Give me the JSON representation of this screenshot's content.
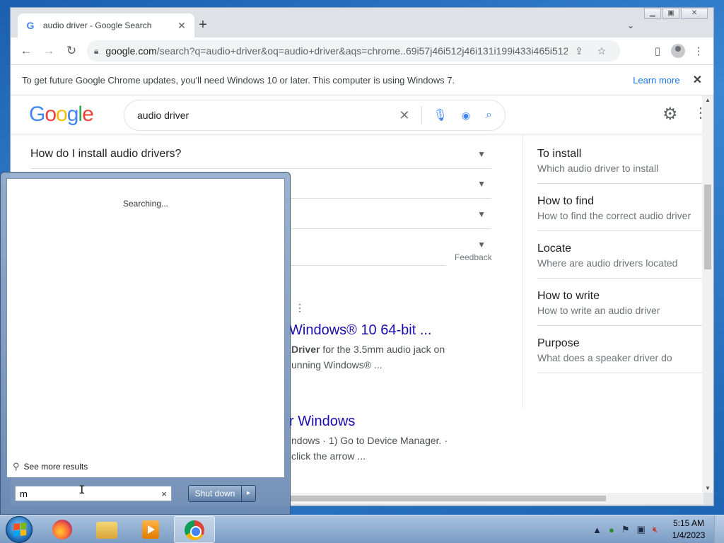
{
  "browser": {
    "tab_title": "audio driver - Google Search",
    "tab_close": "✕",
    "new_tab": "+",
    "url_host": "google.com",
    "url_path": "/search?q=audio+driver&oq=audio+driver&aqs=chrome..69i57j46i512j46i131i199i433i465i512j...",
    "infobar_message": "To get future Google Chrome updates, you'll need Windows 10 or later. This computer is using Windows 7.",
    "infobar_link": "Learn more",
    "infobar_close": "✕"
  },
  "google": {
    "logo": [
      "G",
      "o",
      "o",
      "g",
      "l",
      "e"
    ],
    "query": "audio driver",
    "clear": "✕"
  },
  "paa": {
    "questions": [
      "How do I install audio drivers?",
      "",
      "",
      ""
    ],
    "feedback": "Feedback"
  },
  "results": [
    {
      "title": "Windows® 10 64-bit ...",
      "snippet_bold": "Driver",
      "snippet_1": " for the 3.5mm audio jack on",
      "snippet_2": "unning Windows® ..."
    },
    {
      "title": "r Windows",
      "snippet_1": "ndows · 1) Go to Device Manager. ·",
      "snippet_2": " click the arrow ..."
    }
  ],
  "related": [
    {
      "title": "To install",
      "subtitle": "Which audio driver to install"
    },
    {
      "title": "How to find",
      "subtitle": "How to find the correct audio driver"
    },
    {
      "title": "Locate",
      "subtitle": "Where are audio drivers located"
    },
    {
      "title": "How to write",
      "subtitle": "How to write an audio driver"
    },
    {
      "title": "Purpose",
      "subtitle": "What does a speaker driver do"
    }
  ],
  "start_menu": {
    "status": "Searching...",
    "see_more": "See more results",
    "search_value": "m",
    "search_clear": "×",
    "shutdown_label": "Shut down",
    "shutdown_arrow": "▸"
  },
  "taskbar": {
    "time": "5:15 AM",
    "date": "1/4/2023"
  },
  "colors": {
    "link": "#1a0dab",
    "accent": "#1a73e8",
    "taskbar": "#7a9cc4"
  }
}
